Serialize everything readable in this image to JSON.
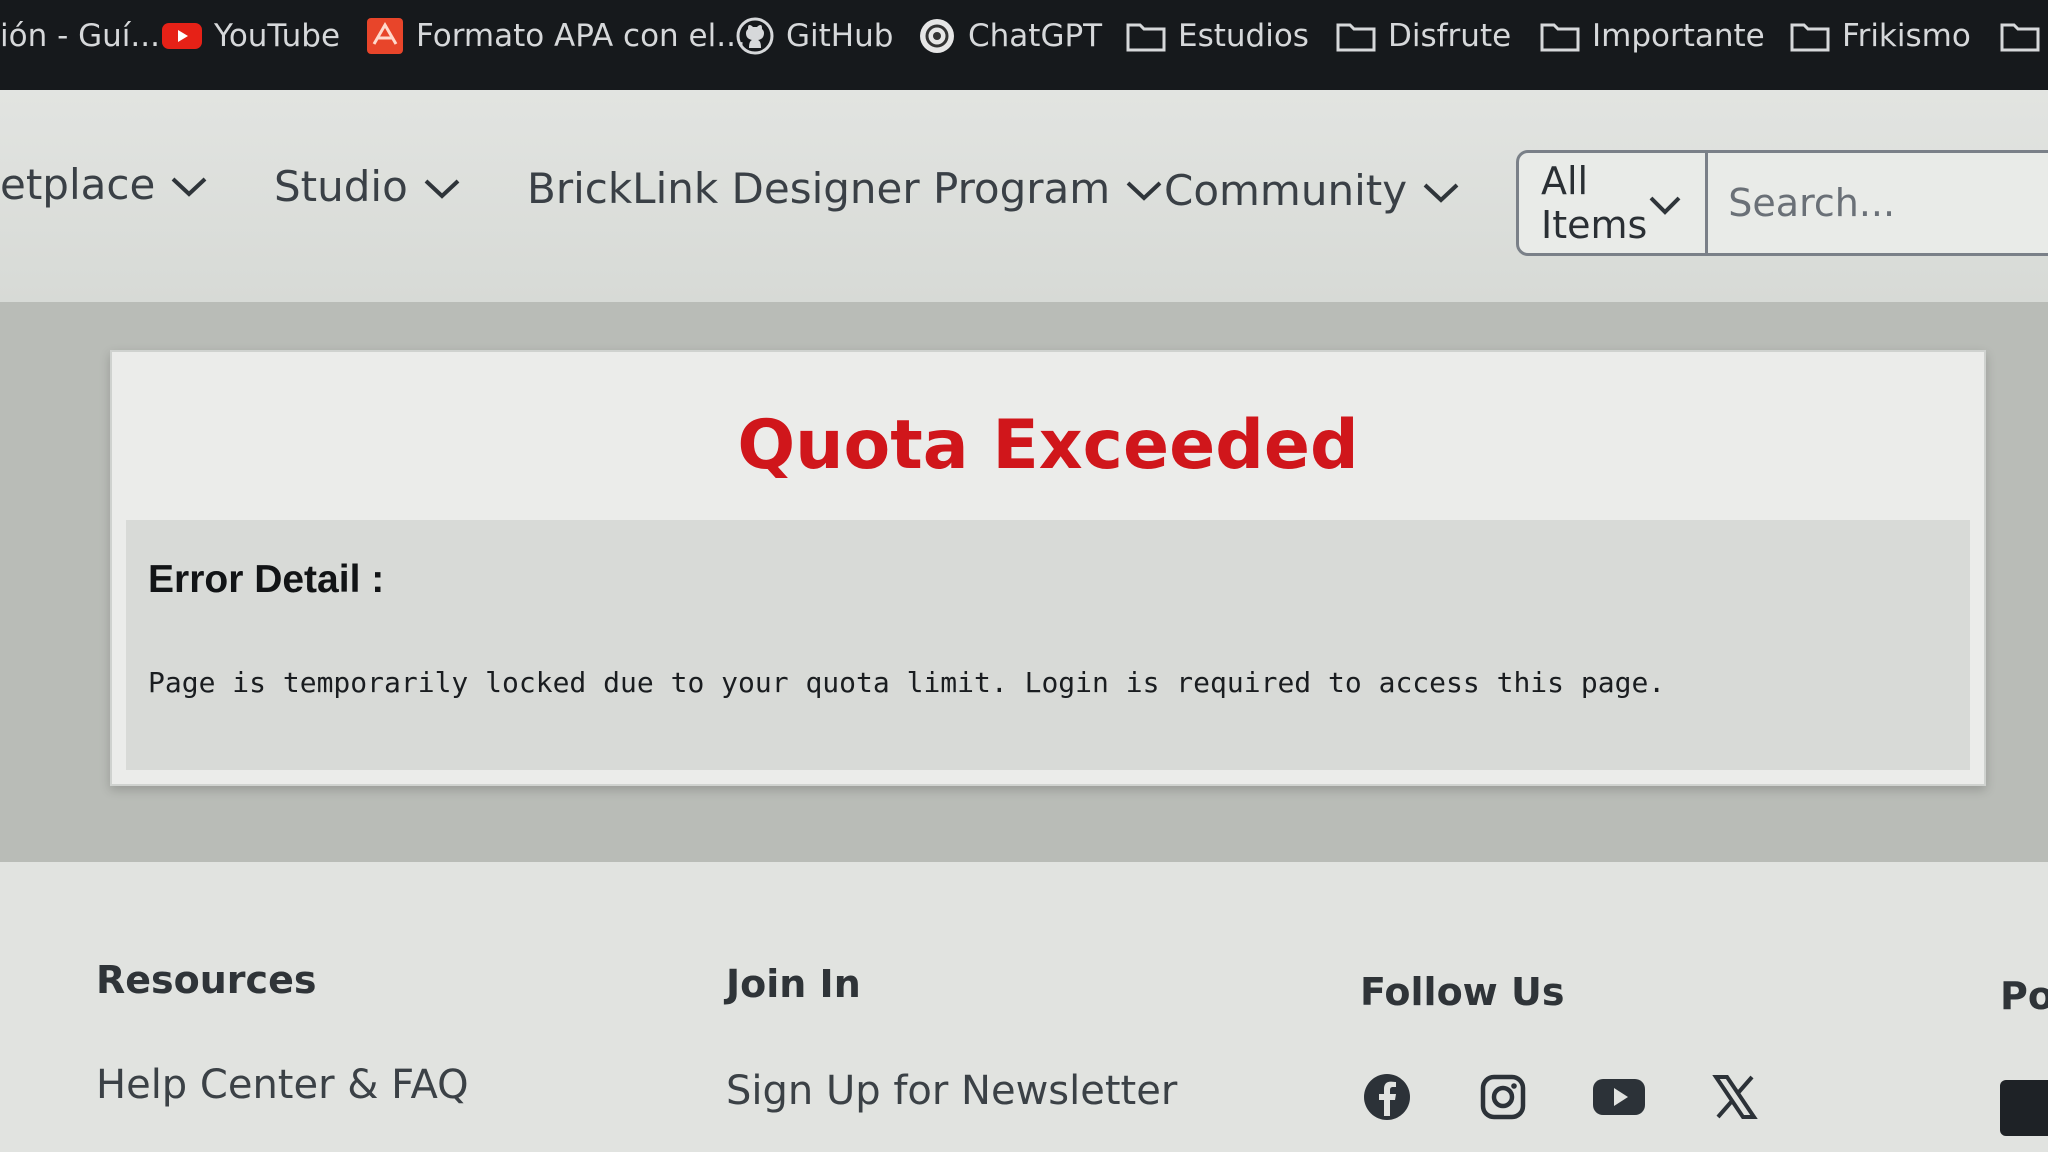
{
  "bookmarks": [
    {
      "label": "ión - Guí...",
      "icon": "none"
    },
    {
      "label": "YouTube",
      "icon": "youtube-icon"
    },
    {
      "label": "Formato APA con el...",
      "icon": "apa-icon"
    },
    {
      "label": "GitHub",
      "icon": "github-icon"
    },
    {
      "label": "ChatGPT",
      "icon": "chatgpt-icon"
    },
    {
      "label": "Estudios",
      "icon": "folder-icon"
    },
    {
      "label": "Disfrute",
      "icon": "folder-icon"
    },
    {
      "label": "Importante",
      "icon": "folder-icon"
    },
    {
      "label": "Frikismo",
      "icon": "folder-icon"
    }
  ],
  "nav": {
    "items": [
      {
        "label": "etplace"
      },
      {
        "label": "Studio"
      },
      {
        "label": "BrickLink Designer Program"
      },
      {
        "label": "Community"
      }
    ],
    "search": {
      "scope": "All Items",
      "placeholder": "Search..."
    }
  },
  "error": {
    "title": "Quota Exceeded",
    "detail_label": "Error Detail :",
    "message": "Page is temporarily locked due to your quota limit. Login is required to access this page."
  },
  "footer": {
    "resources": {
      "heading": "Resources",
      "link": "Help Center & FAQ"
    },
    "join": {
      "heading": "Join In",
      "link": "Sign Up for Newsletter"
    },
    "follow": {
      "heading": "Follow Us",
      "icons": [
        "facebook-icon",
        "instagram-icon",
        "youtube-icon",
        "x-icon"
      ]
    },
    "partial_heading": "Po"
  },
  "colors": {
    "error_title": "#d0161b",
    "bookmarks_bg": "#16191c",
    "youtube_red": "#e62117"
  }
}
